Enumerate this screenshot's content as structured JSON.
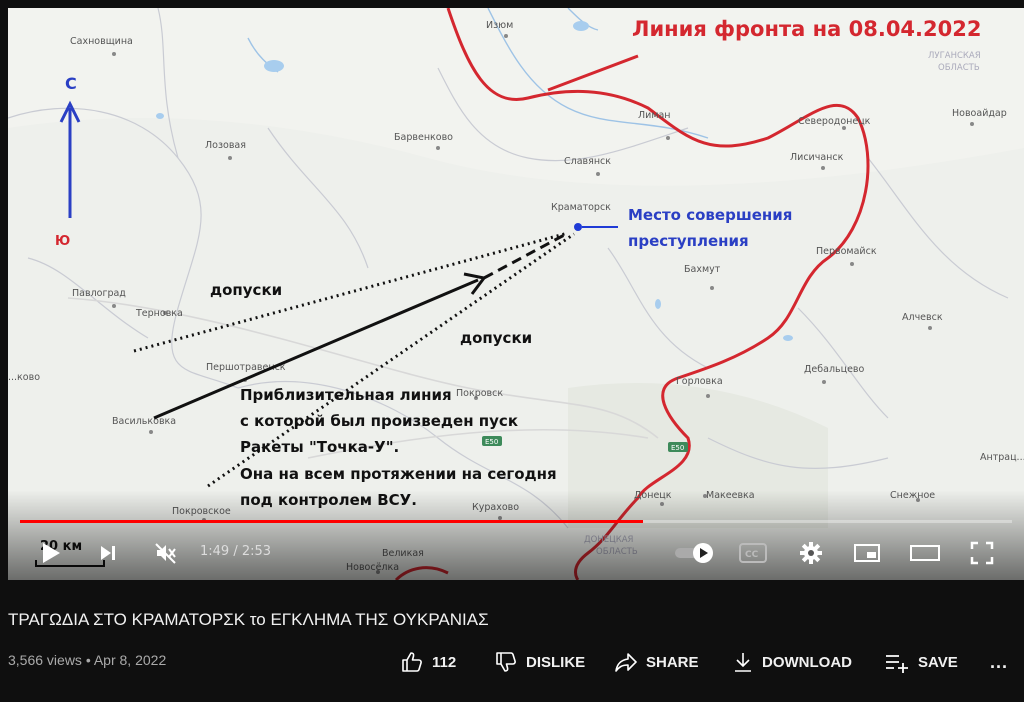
{
  "video": {
    "map": {
      "title": "Линия фронта на 08.04.2022",
      "compass_north": "С",
      "compass_south": "Ю",
      "crime_site": [
        "Место совершения",
        "преступления"
      ],
      "dopuski_1": "допуски",
      "dopuski_2": "допуски",
      "note": [
        "Приблизительная линия",
        "с которой был произведен пуск",
        "Ракеты \"Точка-У\".",
        "Она на всем протяжении на сегодня",
        "под контролем ВСУ."
      ],
      "scale": "20 км",
      "cities": {
        "sakhnovshchina": "Сахновщина",
        "izyum": "Изюм",
        "lozovaya": "Лозовая",
        "barvenkovo": "Барвенково",
        "slavyansk": "Славянск",
        "kramatorsk": "Краматорск",
        "liman": "Лиман",
        "severodonetsk": "Северодонецк",
        "lisichansk": "Лисичанск",
        "novoaidar": "Новоайдар",
        "pavlograd": "Павлоград",
        "ternovka": "Терновка",
        "bakhmut": "Бахмут",
        "pervomaisk": "Первомайск",
        "alchevsk": "Алчевск",
        "pershotravensk": "Першотравенск",
        "pokrovsk": "Покровск",
        "gorlovka": "Горловка",
        "debaltsevo": "Дебальцево",
        "vasilkovka": "Васильковка",
        "novo": "...ково",
        "antratsit": "Антрац...",
        "donetsk": "Донецк",
        "makeevka": "Макеевка",
        "snezhnoe": "Снежное",
        "pokrovskoe": "Покровское",
        "kurakhovo": "Курахово",
        "velikaya": "Великая",
        "novoselka": "Новосёлка",
        "donetsk_oblast": [
          "ДОНЕЦКАЯ",
          "ОБЛАСТЬ"
        ],
        "lugansk_oblast": [
          "ЛУГАНСКАЯ",
          "ОБЛАСТЬ"
        ],
        "road_e50_1": "E50",
        "road_e50_2": "E50"
      }
    },
    "player": {
      "time_display": "1:49 / 2:53",
      "progress_fraction": 0.628,
      "progress_color": "#ff0000"
    }
  },
  "title": "ΤΡΑΓΩΔΙΑ ΣΤΟ ΚΡΑΜΑΤΟΡΣΚ το ΕΓΚΛΗΜΑ ΤΗΣ ΟΥΚΡΑΝΙΑΣ",
  "meta": "3,566 views • Apr 8, 2022",
  "actions": {
    "like_count": "112",
    "dislike": "DISLIKE",
    "share": "SHARE",
    "download": "DOWNLOAD",
    "save": "SAVE",
    "more": "..."
  }
}
